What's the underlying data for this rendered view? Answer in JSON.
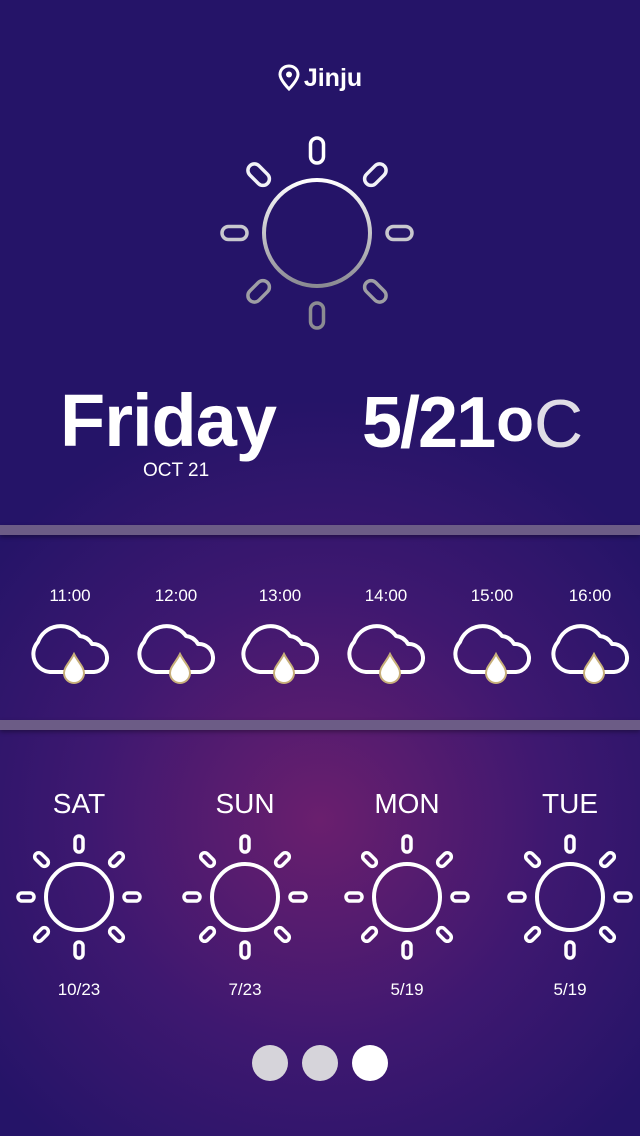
{
  "location": {
    "name": "Jinju",
    "icon": "map-pin-icon"
  },
  "today": {
    "day": "Friday",
    "date": "OCT 21",
    "temperature": "5/21",
    "unit_degree": "o",
    "unit_letter": "C",
    "icon": "sun-icon"
  },
  "hourly": [
    {
      "time": "11:00",
      "icon": "rain-cloud-icon"
    },
    {
      "time": "12:00",
      "icon": "rain-cloud-icon"
    },
    {
      "time": "13:00",
      "icon": "rain-cloud-icon"
    },
    {
      "time": "14:00",
      "icon": "rain-cloud-icon"
    },
    {
      "time": "15:00",
      "icon": "rain-cloud-icon"
    },
    {
      "time": "16:00",
      "icon": "rain-cloud-icon"
    }
  ],
  "daily": [
    {
      "day": "SAT",
      "temp": "10/23",
      "icon": "sun-icon"
    },
    {
      "day": "SUN",
      "temp": "7/23",
      "icon": "sun-icon"
    },
    {
      "day": "MON",
      "temp": "5/19",
      "icon": "sun-icon"
    },
    {
      "day": "TUE",
      "temp": "5/19",
      "icon": "sun-icon"
    }
  ],
  "pager": {
    "pages": 3,
    "active_page": 3
  }
}
